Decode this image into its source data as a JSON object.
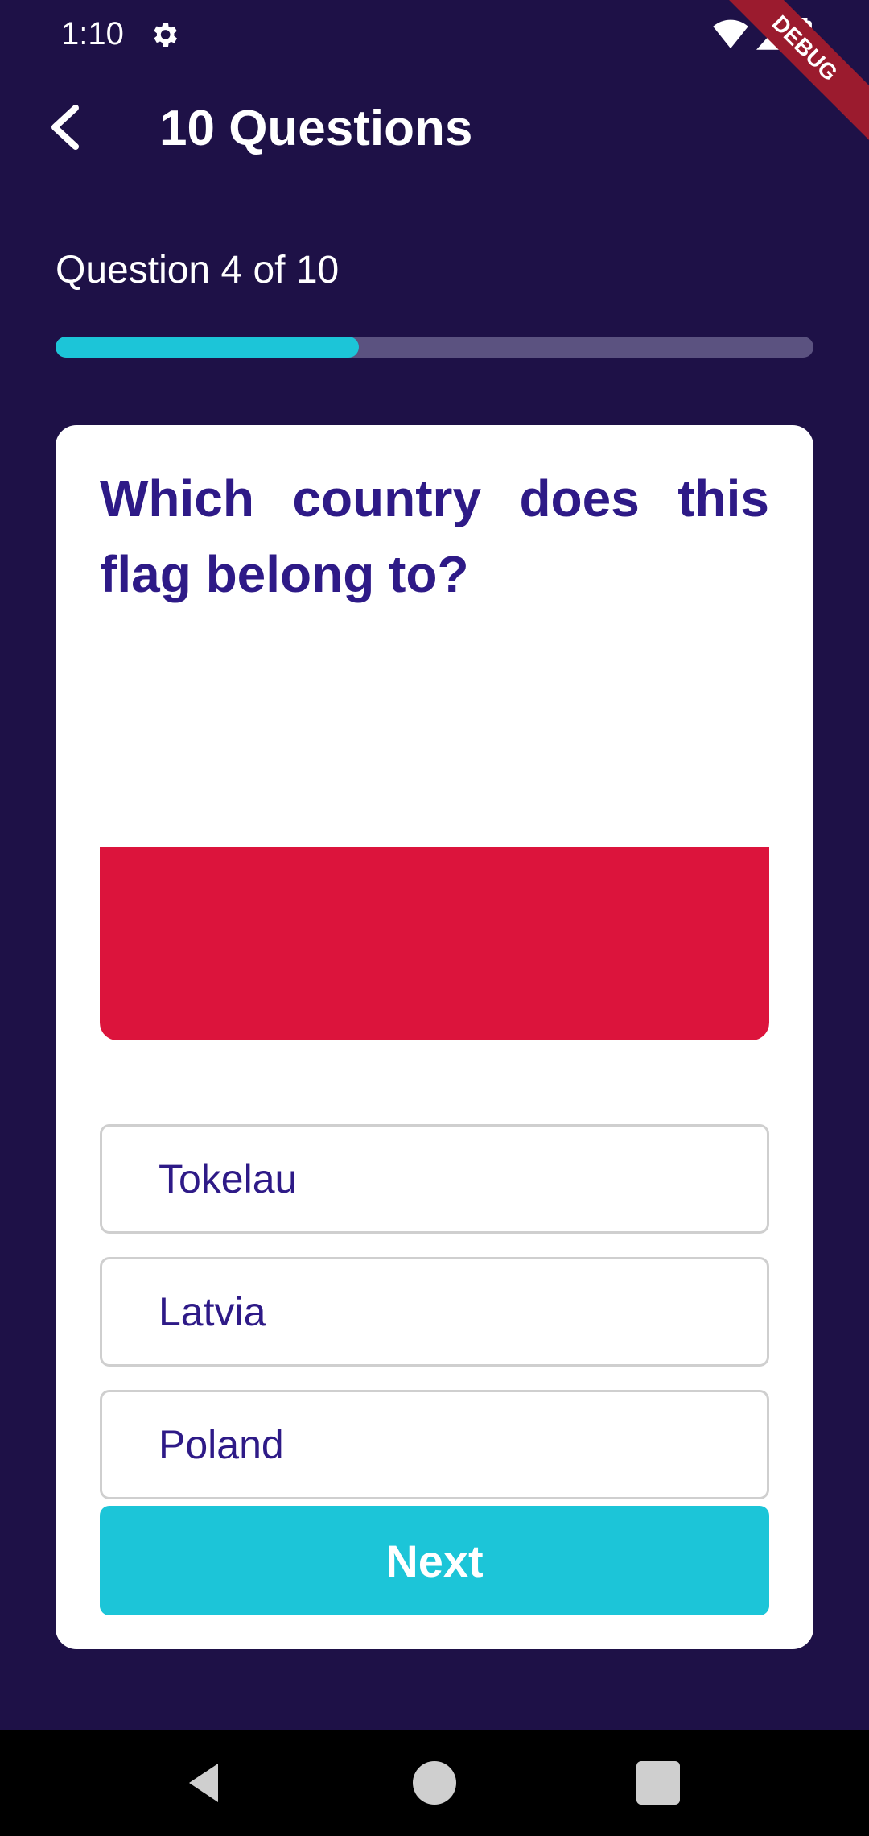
{
  "status_bar": {
    "time": "1:10",
    "debug_label": "DEBUG"
  },
  "app_bar": {
    "title": "10 Questions"
  },
  "progress": {
    "label": "Question 4 of 10",
    "current": 4,
    "total": 10,
    "fraction": 0.4
  },
  "question": {
    "text": "Which country does this flag belong to?"
  },
  "flag": {
    "top_color": "#ffffff",
    "bottom_color": "#dc143c"
  },
  "options": [
    "Tokelau",
    "Latvia",
    "Poland"
  ],
  "next_button": {
    "label": "Next"
  },
  "colors": {
    "background": "#1e1147",
    "accent": "#1cc5d8",
    "primary_text": "#2e1a87"
  }
}
